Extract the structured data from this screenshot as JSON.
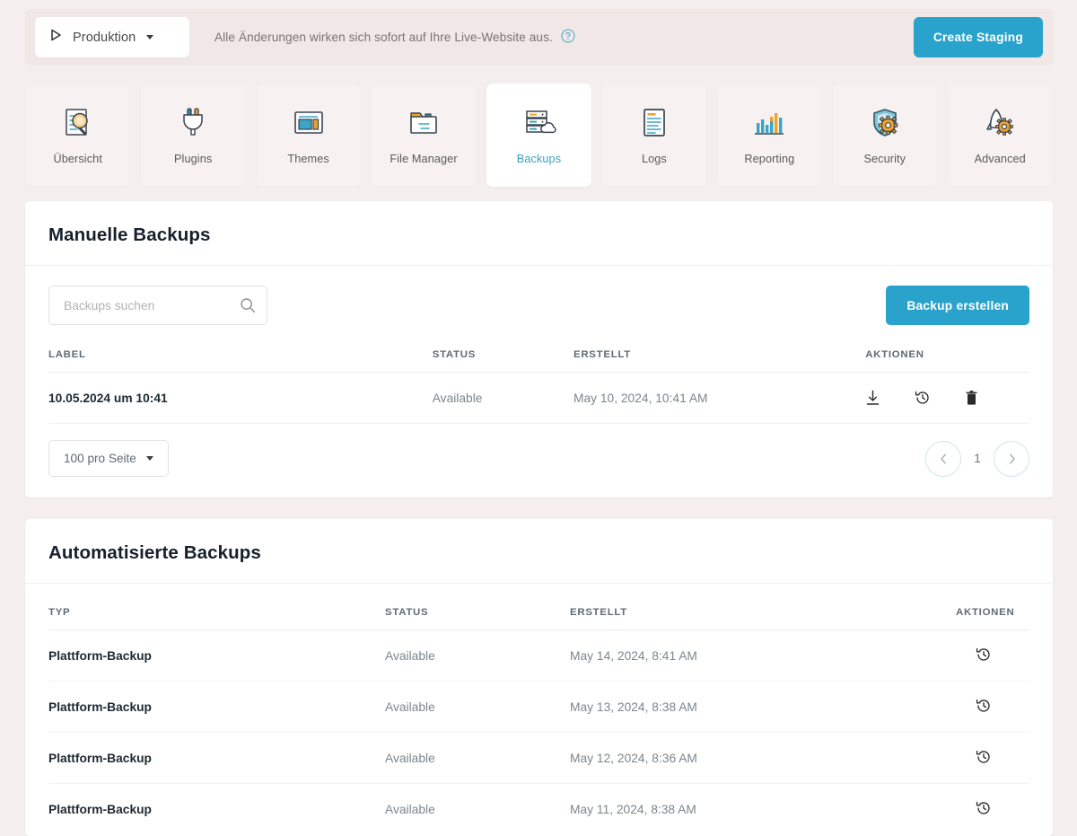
{
  "envbar": {
    "environment_label": "Produktion",
    "environment_icon": "play-triangle-icon",
    "note": "Alle Änderungen wirken sich sofort auf Ihre Live-Website aus.",
    "help_icon": "help-circle-icon",
    "create_staging_label": "Create Staging"
  },
  "tabs": [
    {
      "label": "Übersicht",
      "icon": "document-magnifier-icon",
      "active": false
    },
    {
      "label": "Plugins",
      "icon": "plug-icon",
      "active": false
    },
    {
      "label": "Themes",
      "icon": "layout-window-icon",
      "active": false
    },
    {
      "label": "File Manager",
      "icon": "folder-icon",
      "active": false
    },
    {
      "label": "Backups",
      "icon": "server-cloud-icon",
      "active": true
    },
    {
      "label": "Logs",
      "icon": "document-lines-icon",
      "active": false
    },
    {
      "label": "Reporting",
      "icon": "bar-chart-icon",
      "active": false
    },
    {
      "label": "Security",
      "icon": "shield-gear-icon",
      "active": false
    },
    {
      "label": "Advanced",
      "icon": "rocket-gear-icon",
      "active": false
    }
  ],
  "manual": {
    "title": "Manuelle Backups",
    "search_placeholder": "Backups suchen",
    "search_value": "",
    "search_icon": "search-icon",
    "create_button_label": "Backup erstellen",
    "columns": [
      "LABEL",
      "STATUS",
      "ERSTELLT",
      "AKTIONEN"
    ],
    "rows": [
      {
        "label": "10.05.2024 um 10:41",
        "status": "Available",
        "created": "May 10, 2024, 10:41 AM",
        "actions": [
          "download-icon",
          "restore-clock-icon",
          "trash-icon"
        ]
      }
    ],
    "per_page_label": "100 pro Seite",
    "page_number": "1",
    "prev_icon": "chevron-left-icon",
    "next_icon": "chevron-right-icon"
  },
  "automated": {
    "title": "Automatisierte Backups",
    "columns": [
      "TYP",
      "STATUS",
      "ERSTELLT",
      "AKTIONEN"
    ],
    "rows": [
      {
        "type": "Plattform-Backup",
        "status": "Available",
        "created": "May 14, 2024, 8:41 AM",
        "action": "restore-clock-icon"
      },
      {
        "type": "Plattform-Backup",
        "status": "Available",
        "created": "May 13, 2024, 8:38 AM",
        "action": "restore-clock-icon"
      },
      {
        "type": "Plattform-Backup",
        "status": "Available",
        "created": "May 12, 2024, 8:36 AM",
        "action": "restore-clock-icon"
      },
      {
        "type": "Plattform-Backup",
        "status": "Available",
        "created": "May 11, 2024, 8:38 AM",
        "action": "restore-clock-icon"
      }
    ]
  },
  "colors": {
    "page_background": "#f4efee",
    "envbar_background": "#f2e7e7",
    "accent_blue": "#29a3cb",
    "active_tab_text": "#3da0c4",
    "icon_orange": "#f0a32a",
    "icon_teal": "#3aa5c4",
    "heading_text": "#16202a",
    "muted_text": "#7c868d"
  }
}
